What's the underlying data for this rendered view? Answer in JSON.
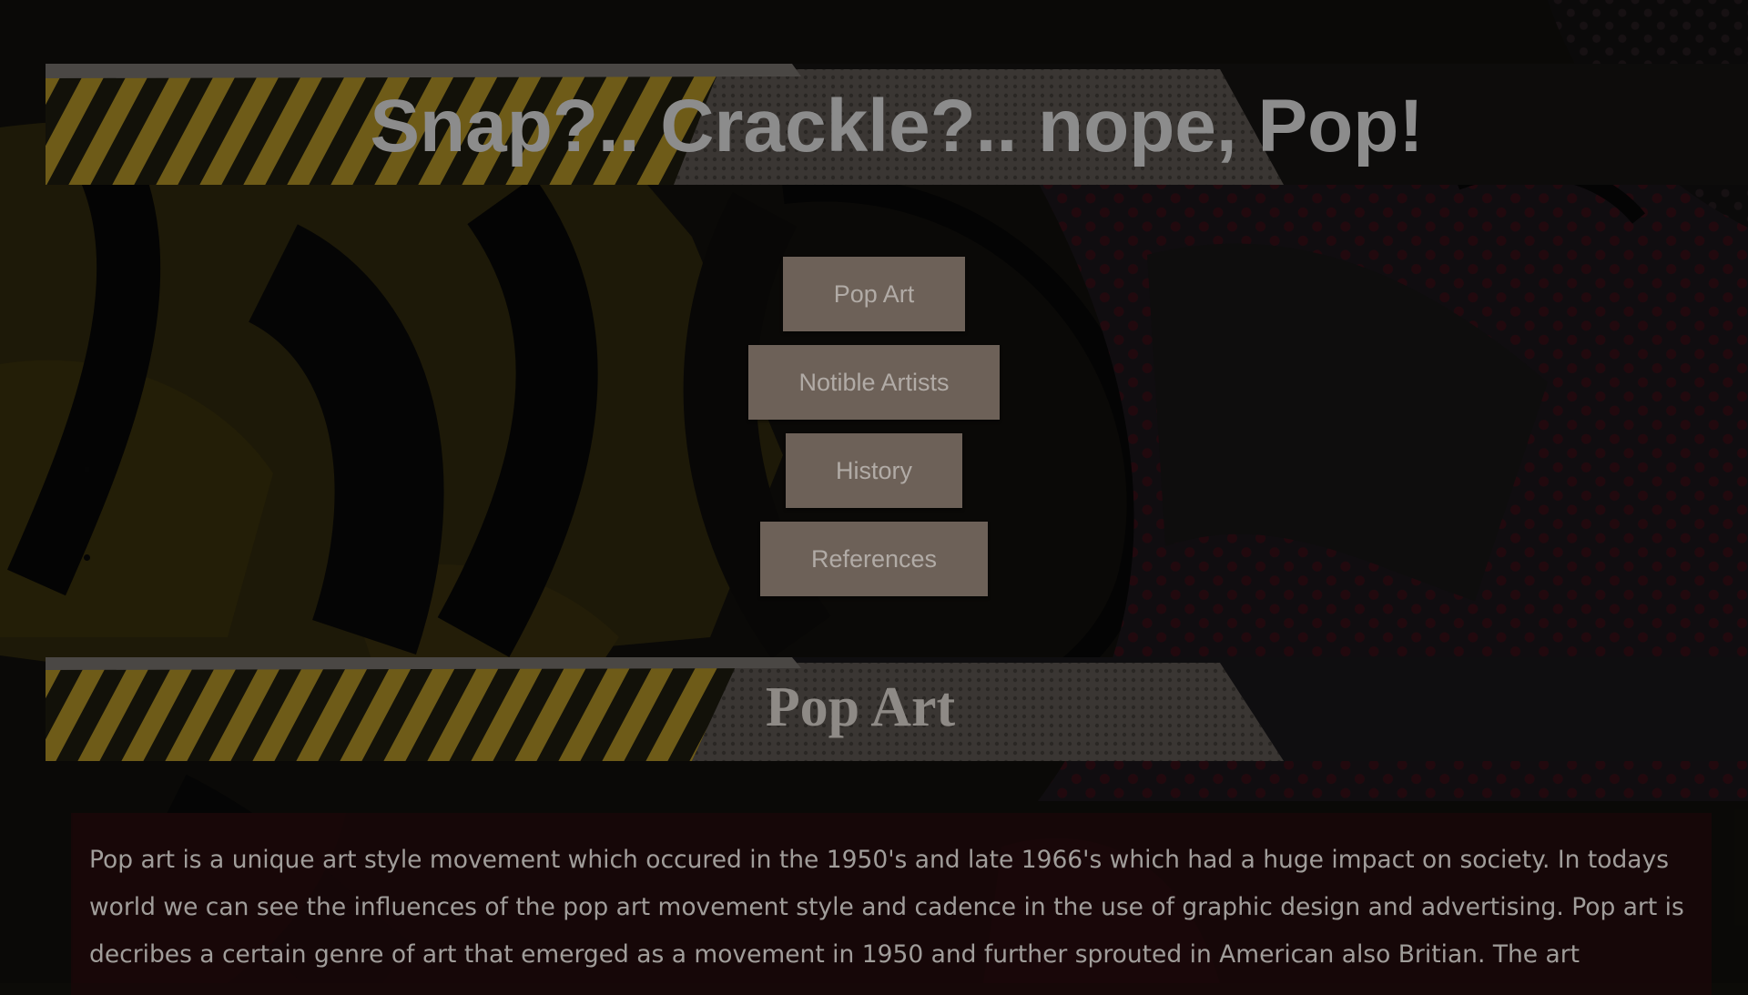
{
  "site": {
    "title": "Snap?.. Crackle?.. nope, Pop!"
  },
  "nav": {
    "items": [
      {
        "label": "Pop Art"
      },
      {
        "label": "Notible Artists"
      },
      {
        "label": "History"
      },
      {
        "label": "References"
      }
    ]
  },
  "section": {
    "heading": "Pop Art",
    "paragraph": "Pop art is a unique art style movement which occured in the 1950's and late 1966's which had a huge impact on society. In todays world we can see the influences of the pop art movement style and cadence in the use of graphic design and advertising. Pop art is decribes a certain genre of art that emerged as a movement in 1950 and further sprouted in American also Britian. The art"
  },
  "colors": {
    "button_bg": "#6d6158",
    "button_text": "#b1aba6",
    "banner_stripe_yellow": "#7a6418",
    "title_text": "#8c8c8c",
    "article_bg": "#190709"
  }
}
